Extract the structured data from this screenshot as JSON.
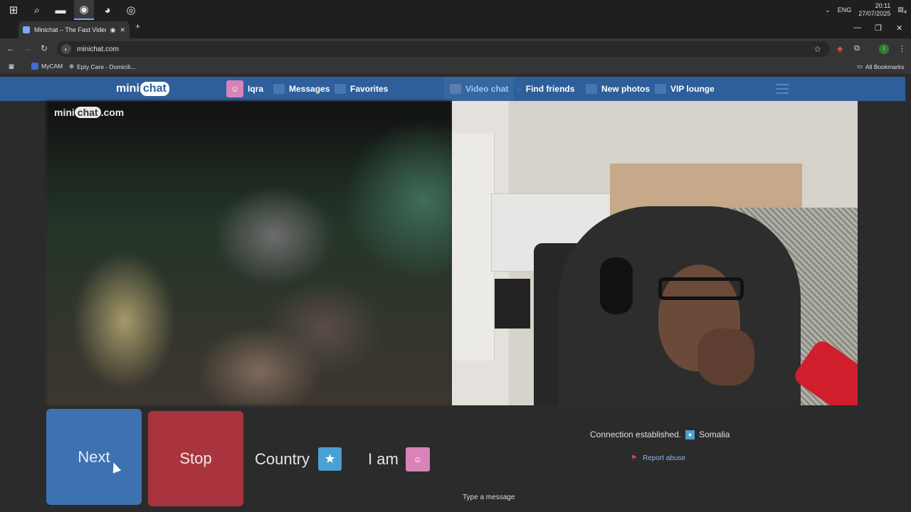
{
  "taskbar": {
    "icons": [
      "windows-icon",
      "search-icon",
      "file-explorer-icon",
      "chrome-icon",
      "discord-icon",
      "app-icon"
    ],
    "lang": "ENG",
    "time": "20:11",
    "date": "27/07/2025",
    "notifications": "4"
  },
  "browser": {
    "tab_title": "Minichat – The Fast Video C",
    "new_tab": "+",
    "url": "minichat.com",
    "bookmarks": [
      {
        "label": "MyCAM"
      },
      {
        "label": "Epty Care - Domicili..."
      }
    ],
    "all_bookmarks": "All Bookmarks",
    "profile_initial": "I"
  },
  "site": {
    "logo_left": "mini",
    "logo_bubble": "chat",
    "logo_suffix": ".com",
    "nav": {
      "profile": "Iqra",
      "messages": "Messages",
      "favorites": "Favorites",
      "video_chat": "Video chat",
      "find_friends": "Find friends",
      "new_photos": "New photos",
      "vip_lounge": "VIP lounge"
    }
  },
  "controls": {
    "next": "Next",
    "stop": "Stop",
    "country": "Country",
    "i_am": "I am",
    "status": "Connection established.",
    "country_name": "Somalia",
    "report": "Report abuse",
    "message_placeholder": "Type a message"
  },
  "colors": {
    "nav_bg": "#2f5f9a",
    "next_bg": "#3d72b1",
    "stop_bg": "#a9343e",
    "accent_pink": "#d884b8",
    "flag_blue": "#4aa0d2"
  }
}
